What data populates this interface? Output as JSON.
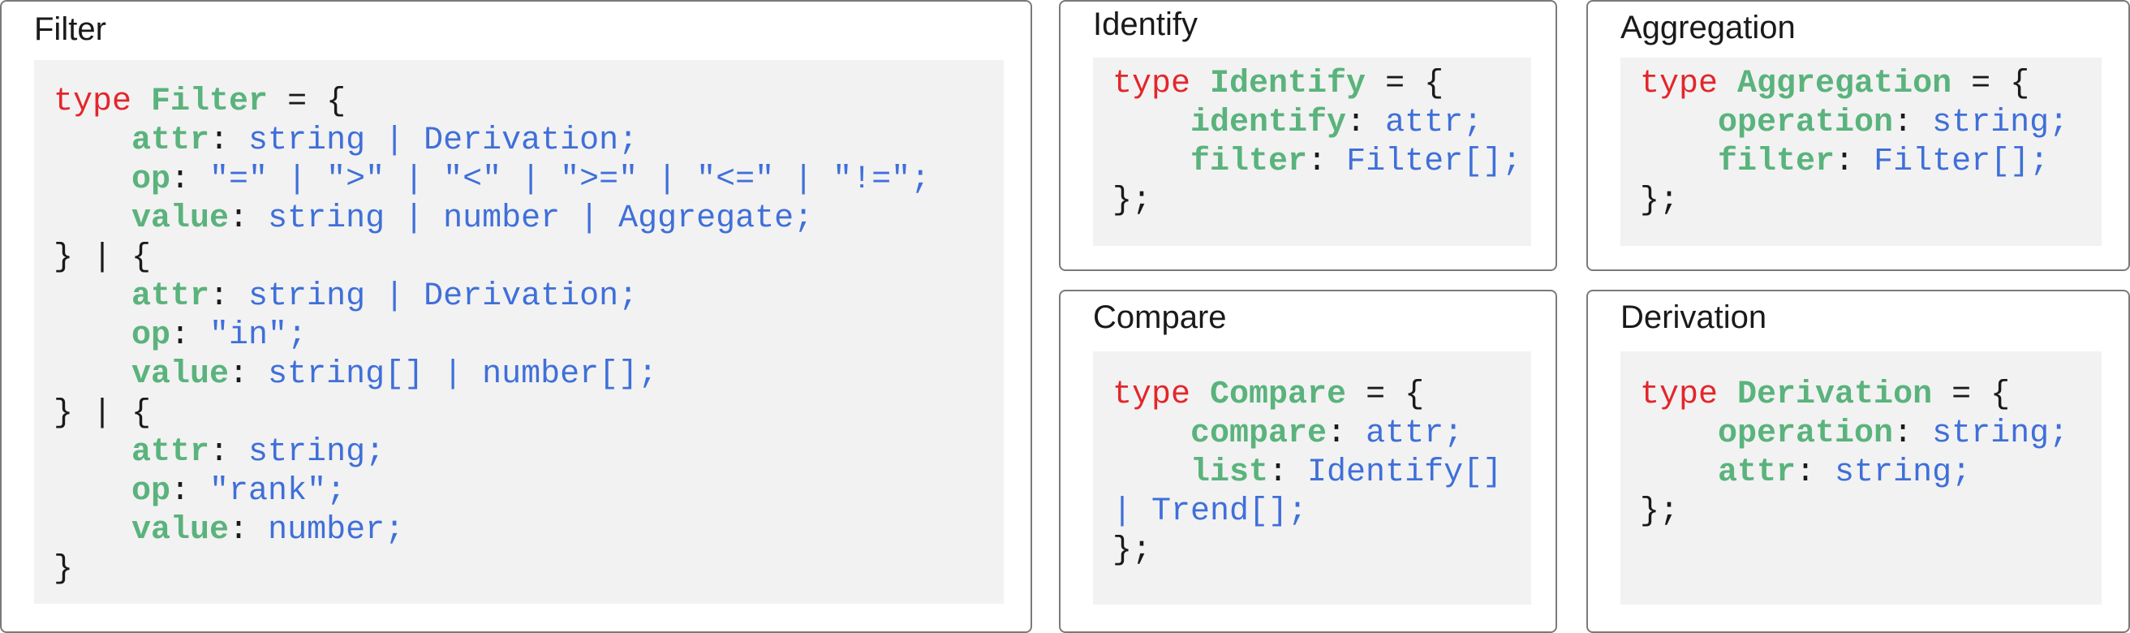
{
  "colors": {
    "keyword": "#e3262b",
    "type_name": "#5ab37c",
    "property": "#5ab37c",
    "type_value": "#3f6fd9",
    "punctuation": "#1a1a1a",
    "code_background": "#f2f2f2",
    "panel_border": "#7a7a7a"
  },
  "panels": [
    {
      "id": "filter",
      "title": "Filter",
      "lines": [
        [
          [
            "kw",
            "type "
          ],
          [
            "tn",
            "Filter"
          ],
          [
            "pn",
            " = {"
          ]
        ],
        [
          [
            "pn",
            "    "
          ],
          [
            "pk",
            "attr"
          ],
          [
            "pn",
            ": "
          ],
          [
            "tv",
            "string | Derivation;"
          ]
        ],
        [
          [
            "pn",
            "    "
          ],
          [
            "pk",
            "op"
          ],
          [
            "pn",
            ": "
          ],
          [
            "tv",
            "\"=\" | \">\" | \"<\" | \">=\" | \"<=\" | \"!=\";"
          ]
        ],
        [
          [
            "pn",
            "    "
          ],
          [
            "pk",
            "value"
          ],
          [
            "pn",
            ": "
          ],
          [
            "tv",
            "string | number | Aggregate;"
          ]
        ],
        [
          [
            "pn",
            "} | {"
          ]
        ],
        [
          [
            "pn",
            "    "
          ],
          [
            "pk",
            "attr"
          ],
          [
            "pn",
            ": "
          ],
          [
            "tv",
            "string | Derivation;"
          ]
        ],
        [
          [
            "pn",
            "    "
          ],
          [
            "pk",
            "op"
          ],
          [
            "pn",
            ": "
          ],
          [
            "tv",
            "\"in\";"
          ]
        ],
        [
          [
            "pn",
            "    "
          ],
          [
            "pk",
            "value"
          ],
          [
            "pn",
            ": "
          ],
          [
            "tv",
            "string[] | number[];"
          ]
        ],
        [
          [
            "pn",
            "} | {"
          ]
        ],
        [
          [
            "pn",
            "    "
          ],
          [
            "pk",
            "attr"
          ],
          [
            "pn",
            ": "
          ],
          [
            "tv",
            "string;"
          ]
        ],
        [
          [
            "pn",
            "    "
          ],
          [
            "pk",
            "op"
          ],
          [
            "pn",
            ": "
          ],
          [
            "tv",
            "\"rank\";"
          ]
        ],
        [
          [
            "pn",
            "    "
          ],
          [
            "pk",
            "value"
          ],
          [
            "pn",
            ": "
          ],
          [
            "tv",
            "number;"
          ]
        ],
        [
          [
            "pn",
            "}"
          ]
        ]
      ]
    },
    {
      "id": "identify",
      "title": "Identify",
      "lines": [
        [
          [
            "kw",
            "type "
          ],
          [
            "tn",
            "Identify"
          ],
          [
            "pn",
            " = {"
          ]
        ],
        [
          [
            "pn",
            "    "
          ],
          [
            "pk",
            "identify"
          ],
          [
            "pn",
            ": "
          ],
          [
            "tv",
            "attr;"
          ]
        ],
        [
          [
            "pn",
            "    "
          ],
          [
            "pk",
            "filter"
          ],
          [
            "pn",
            ": "
          ],
          [
            "tv",
            "Filter[];"
          ]
        ],
        [
          [
            "pn",
            "};"
          ]
        ]
      ]
    },
    {
      "id": "aggregation",
      "title": "Aggregation",
      "lines": [
        [
          [
            "kw",
            "type "
          ],
          [
            "tn",
            "Aggregation"
          ],
          [
            "pn",
            " = {"
          ]
        ],
        [
          [
            "pn",
            "    "
          ],
          [
            "pk",
            "operation"
          ],
          [
            "pn",
            ": "
          ],
          [
            "tv",
            "string;"
          ]
        ],
        [
          [
            "pn",
            "    "
          ],
          [
            "pk",
            "filter"
          ],
          [
            "pn",
            ": "
          ],
          [
            "tv",
            "Filter[];"
          ]
        ],
        [
          [
            "pn",
            "};"
          ]
        ]
      ]
    },
    {
      "id": "compare",
      "title": "Compare",
      "lines": [
        [
          [
            "kw",
            "type "
          ],
          [
            "tn",
            "Compare"
          ],
          [
            "pn",
            " = {"
          ]
        ],
        [
          [
            "pn",
            "    "
          ],
          [
            "pk",
            "compare"
          ],
          [
            "pn",
            ": "
          ],
          [
            "tv",
            "attr;"
          ]
        ],
        [
          [
            "pn",
            "    "
          ],
          [
            "pk",
            "list"
          ],
          [
            "pn",
            ": "
          ],
          [
            "tv",
            "Identify[]"
          ]
        ],
        [
          [
            "tv",
            "| Trend[];"
          ]
        ],
        [
          [
            "pn",
            "};"
          ]
        ]
      ]
    },
    {
      "id": "derivation",
      "title": "Derivation",
      "lines": [
        [
          [
            "kw",
            "type "
          ],
          [
            "tn",
            "Derivation"
          ],
          [
            "pn",
            " = {"
          ]
        ],
        [
          [
            "pn",
            "    "
          ],
          [
            "pk",
            "operation"
          ],
          [
            "pn",
            ": "
          ],
          [
            "tv",
            "string;"
          ]
        ],
        [
          [
            "pn",
            "    "
          ],
          [
            "pk",
            "attr"
          ],
          [
            "pn",
            ": "
          ],
          [
            "tv",
            "string;"
          ]
        ],
        [
          [
            "pn",
            "};"
          ]
        ]
      ]
    }
  ]
}
